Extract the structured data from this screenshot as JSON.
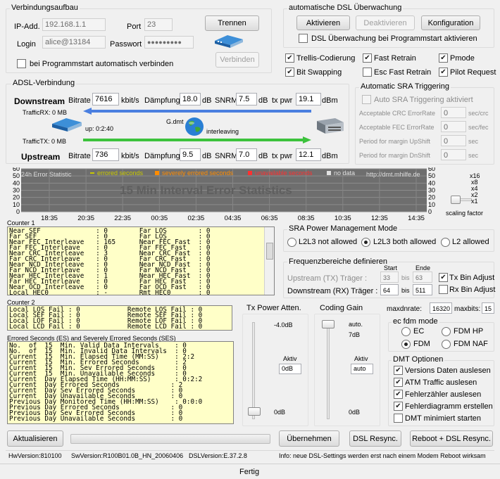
{
  "conn": {
    "title": "Verbindungsaufbau",
    "ip_label": "IP-Add.",
    "ip_value": "192.168.1.1",
    "port_label": "Port",
    "port_value": "23",
    "login_label": "Login",
    "login_value": "alice@13184",
    "pass_label": "Passwort",
    "pass_value": "●●●●●●●●●",
    "btn_disconnect": "Trennen",
    "btn_connect": "Verbinden",
    "autoconnect_label": "bei Programmstart automatisch verbinden",
    "autoconnect": false
  },
  "auto": {
    "title": "automatische DSL Überwachung",
    "btn_activate": "Aktivieren",
    "btn_deactivate": "Deaktivieren",
    "btn_config": "Konfiguration",
    "start_label": "DSL Überwachung bei Programmstart aktivieren"
  },
  "features": [
    {
      "label": "Trellis-Codierung",
      "on": true
    },
    {
      "label": "Fast Retrain",
      "on": true
    },
    {
      "label": "Pmode",
      "on": true
    },
    {
      "label": "Bit Swapping",
      "on": true
    },
    {
      "label": "Esc Fast Retrain",
      "on": false
    },
    {
      "label": "Pilot Request",
      "on": true
    }
  ],
  "adsl": {
    "title": "ADSL-Verbindung",
    "down_label": "Downstream",
    "up_label": "Upstream",
    "bitrate_label": "Bitrate",
    "kbit": "kbit/s",
    "attn_label": "Dämpfung",
    "db": "dB",
    "snrm_label": "SNRM",
    "txpwr_label": "tx pwr",
    "dbm": "dBm",
    "down": {
      "bitrate": "7616",
      "attn": "18.0",
      "snrm": "7.5",
      "txpwr": "19.1"
    },
    "up": {
      "bitrate": "736",
      "attn": "9.5",
      "snrm": "7.0",
      "txpwr": "12.1"
    },
    "traffic_rx": "TrafficRX: 0 MB",
    "traffic_tx": "TrafficTX: 0 MB",
    "uptime": "up: 0:2:40",
    "mode": "G.dmt",
    "interleave": "interleaving"
  },
  "sra": {
    "title": "Automatic SRA Triggering",
    "auto_label": "Auto SRA Triggering aktiviert",
    "rows": [
      {
        "label": "Acceptable CRC ErrorRate",
        "value": "0",
        "unit": "sec/crc"
      },
      {
        "label": "Acceptable FEC ErrorRate",
        "value": "0",
        "unit": "sec/fec"
      },
      {
        "label": "Period for margin UpShift",
        "value": "0",
        "unit": "sec"
      },
      {
        "label": "Period for margin DnShift",
        "value": "0",
        "unit": "sec"
      }
    ]
  },
  "chart": {
    "title": "15 Min Interval Error Statistics",
    "legend_title": "24h Error Statistic",
    "legend": [
      {
        "label": "errored seconds",
        "color": "#c8c800",
        "marker": "line"
      },
      {
        "label": "severely errored seconds",
        "color": "#ff8c00",
        "marker": "box"
      },
      {
        "label": "unavailable seconds",
        "color": "#ff3030",
        "marker": "box"
      },
      {
        "label": "no data",
        "color": "#e0e0e0",
        "marker": "box"
      }
    ],
    "url": "http://dmt.mhilfe.de",
    "y_ticks": [
      "60",
      "50",
      "40",
      "30",
      "20",
      "10",
      "0"
    ],
    "x_ticks": [
      "18:35",
      "20:35",
      "22:35",
      "00:35",
      "02:35",
      "04:35",
      "06:35",
      "08:35",
      "10:35",
      "12:35",
      "14:35"
    ],
    "scale_ticks": [
      "x16",
      "x8",
      "x4",
      "x2",
      "x1"
    ],
    "scaling_label": "scaling factor"
  },
  "chart_data": {
    "type": "bar",
    "title": "15 Min Interval Error Statistics",
    "xlabel": "",
    "ylabel": "",
    "categories": [
      "18:35",
      "20:35",
      "22:35",
      "00:35",
      "02:35",
      "04:35",
      "06:35",
      "08:35",
      "10:35",
      "12:35",
      "14:35"
    ],
    "series": [
      {
        "name": "errored seconds",
        "values": []
      },
      {
        "name": "severely errored seconds",
        "values": []
      },
      {
        "name": "unavailable seconds",
        "values": []
      }
    ],
    "ylim": [
      0,
      60
    ],
    "grid": true
  },
  "counter1": {
    "title": "Counter 1",
    "lines": [
      "Near SEF              : 0        Far LOS        : 0",
      "Far SEF               : 0        Far LOS        : 0",
      "Near FEC Interleave   : 165      Near FEC Fast  : 0",
      "Far FEC Interleave    : 0        Far FEC Fast   : 0",
      "Near CRC Interleave   : 3        Near CRC Fast  : 0",
      "Far CRC Interleave    : 0        Far CRC Fast   : 0",
      "Near NCD Interleave   : 0        Near NCD Fast  : 0",
      "Far NCD Interleave    : 0        Far NCD Fast   : 0",
      "Near HEC Interleave   : 1        Near HEC Fast  : 0",
      "Far HEC Interleave    : 0        Far HEC Fast   : 0",
      "Near OCD Interleave   : 0        Far OCD Fast   : 0",
      "Local HEC0            : -        Rmt HEC0       : 0"
    ]
  },
  "counter2": {
    "title": "Counter 2",
    "lines": [
      "Local LOS Fail : 0            Remote LOS Fail : 0",
      "Local SEF Fail : 0            Remote SEF Fail : 0",
      "Local LOF Fail : 0            Remote LOF Fail : 0",
      "Local LCD Fail : 0            Remote LCD Fail : 0"
    ]
  },
  "es": {
    "title": "Errored Seconds (ES) and Severely Errored Seconds (SES)",
    "lines": [
      "No.  of  15  Min. Valid Data Intervals    : 0",
      "No.  of  15  Min. Invalid Data Intervals  : 0",
      "Current  15  Min. Elapsed Time (MM:SS)    : 2:2",
      "Current  15  Min. Errored Seconds         : 2",
      "Current  15  Min. Sev Errored Seconds     : 0",
      "Current  15  Min. Unavailable Seconds     : 0",
      "Current  Day Elapsed Time (HH:MM:SS)      : 0:2:2",
      "Current  Day Errored Seconds             : 2",
      "Current  Day Sev Errored Seconds         : 0",
      "Current  Day Unavailable Seconds         : 0",
      "Previous Day Monitored Time (HH:MM:SS)    : 0:0:0",
      "Previous Day Errored Seconds             : 0",
      "Previous Day Sev Errored Seconds         : 0",
      "Previous Day Unavailable Seconds         : 0"
    ]
  },
  "power": {
    "title": "Tx Power Atten.",
    "top": "-4.0dB",
    "bottom": "0dB",
    "aktiv_label": "Aktiv",
    "aktiv_value": "0dB"
  },
  "gain": {
    "title": "Coding Gain",
    "top": "auto.",
    "top2": "7dB",
    "bottom": "0dB",
    "aktiv_label": "Aktiv",
    "aktiv_value": "auto"
  },
  "srapm": {
    "title": "SRA Power Management Mode",
    "options": [
      {
        "label": "L2L3 not allowed",
        "on": false
      },
      {
        "label": "L2L3 both allowed",
        "on": true
      },
      {
        "label": "L2 allowed",
        "on": false
      }
    ]
  },
  "freq": {
    "title": "Frequenzbereiche definieren",
    "start": "Start",
    "ende": "Ende",
    "up_label": "Upstream (TX) Träger :",
    "up_start": "33",
    "up_end": "63",
    "down_label": "Downstream (RX) Träger :",
    "down_start": "64",
    "down_end": "511",
    "bis": "bis",
    "tx_adjust": "Tx Bin Adjust",
    "rx_adjust": "Rx Bin Adjust",
    "tx_on": true,
    "rx_on": false
  },
  "maxdn": {
    "label": "maxdnrate:",
    "value": "16320",
    "bits_label": "maxbits:",
    "bits_value": "15"
  },
  "fdm": {
    "title": "ec fdm mode",
    "options": [
      {
        "label": "EC",
        "on": false
      },
      {
        "label": "FDM HP",
        "on": false
      },
      {
        "label": "FDM",
        "on": true
      },
      {
        "label": "FDM NAF",
        "on": false
      }
    ]
  },
  "dmt": {
    "title": "DMT Optionen",
    "options": [
      {
        "label": "Versions Daten auslesen",
        "on": true
      },
      {
        "label": "ATM Traffic auslesen",
        "on": true
      },
      {
        "label": "Fehlerzähler auslesen",
        "on": true
      },
      {
        "label": "Fehlerdiagramm erstellen",
        "on": true
      },
      {
        "label": "DMT minimiert starten",
        "on": false
      }
    ]
  },
  "bottom": {
    "refresh": "Aktualisieren",
    "apply": "Übernehmen",
    "resync": "DSL Resync.",
    "reboot": "Reboot + DSL Resync."
  },
  "status": {
    "hw": "HwVersion:810100",
    "sw": "SwVersion:R100B01.0B_HN_20060406",
    "dsl": "DSLVersion:E.37.2.8",
    "info": "Info: neue DSL-Settings werden erst nach einem Modem Reboot wirksam",
    "ready": "Fertig"
  }
}
